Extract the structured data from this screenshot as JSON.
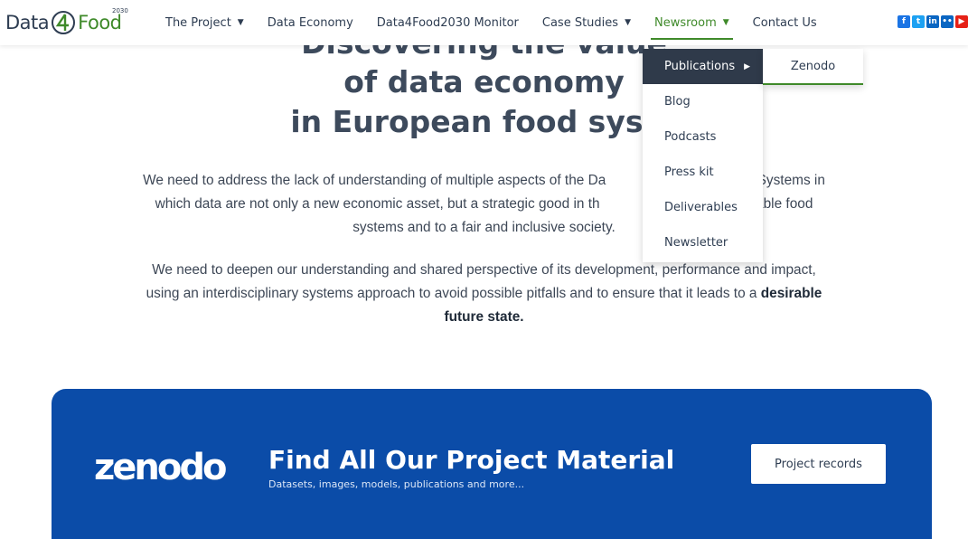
{
  "header": {
    "logo": {
      "part1": "Data",
      "part2": "Food",
      "year": "2030"
    },
    "nav": [
      {
        "label": "The Project",
        "has_caret": true
      },
      {
        "label": "Data Economy",
        "has_caret": false
      },
      {
        "label": "Data4Food2030 Monitor",
        "has_caret": false
      },
      {
        "label": "Case Studies",
        "has_caret": true
      },
      {
        "label": "Newsroom",
        "has_caret": true,
        "active": true
      },
      {
        "label": "Contact Us",
        "has_caret": false
      }
    ],
    "social_icons": [
      "facebook-icon",
      "twitter-icon",
      "linkedin-icon",
      "flickr-icon",
      "youtube-icon"
    ]
  },
  "hero": {
    "title_line1": "Discovering the value",
    "title_line2": "of data economy",
    "title_line3": "in European food syste",
    "para1_line1": "We need to address the lack of understanding of multiple aspects of the Da",
    "para1_line1_right": "Food Systems in",
    "para1_line2": "which data are not only a new economic asset, but a strategic good in th",
    "para1_line2_right": "stainable food",
    "para1_line3": "systems and to a fair and inclusive society.",
    "para2_line1": "We need to deepen our understanding and shared perspective of its development, performance and impact,",
    "para2_line2": "using an interdisciplinary systems approach to avoid possible pitfalls and to ensure that it leads to a",
    "para2_bold1": "desirable",
    "para2_bold2": "future state."
  },
  "dropdown": {
    "items": [
      "Publications",
      "Blog",
      "Podcasts",
      "Press kit",
      "Deliverables",
      "Newsletter"
    ],
    "submenu_item": "Zenodo"
  },
  "banner": {
    "logo_text": "zenodo",
    "title": "Find All Our Project Material",
    "subtitle": "Datasets, images, models, publications and more...",
    "button": "Project records"
  },
  "colors": {
    "brand_green": "#3f8a2a",
    "navy": "#2f3a4a",
    "banner_blue": "#0b4ca8"
  }
}
